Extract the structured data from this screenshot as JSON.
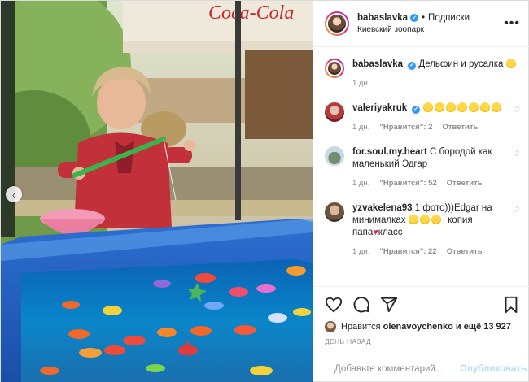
{
  "photo": {
    "background_sign": "Coca-Cola",
    "alt": "Девочка ловит игрушечную рыбку удочкой в надувном бассейне"
  },
  "header": {
    "username": "babaslavka",
    "separator": "•",
    "follow_state": "Подписки",
    "location": "Киевский зоопарк",
    "more": "•••"
  },
  "caption": {
    "username": "babaslavka",
    "text": "Дельфин и русалка",
    "time": "1 дн."
  },
  "comments": [
    {
      "username": "valeriyakruk",
      "verified": true,
      "time": "1 дн.",
      "likes": "\"Нравится\": 2",
      "reply": "Ответить"
    },
    {
      "username": "for.soul.my.heart",
      "text": "С бородой как маленький Эдгар",
      "time": "1 дн.",
      "likes": "\"Нравится\": 52",
      "reply": "Ответить"
    },
    {
      "username": "yzvakelena93",
      "text_parts": [
        "1 фото)))Edgar на минималках",
        ", копия папа",
        "класс"
      ],
      "time": "1 дн.",
      "likes": "\"Нравится\": 22",
      "reply": "Ответить"
    }
  ],
  "actions": {
    "likes_prefix": "Нравится",
    "liked_by": "olenavoychenko",
    "likes_suffix": "и ещё 13 927",
    "date": "ДЕНЬ НАЗАД"
  },
  "composer": {
    "placeholder": "Добавьте комментарий...",
    "publish": "Опубликовать"
  },
  "icons": [
    "chevron-left-icon",
    "verified-icon",
    "more-icon",
    "heart-icon",
    "comment-icon",
    "share-icon",
    "bookmark-icon",
    "smile-icon"
  ],
  "colors": {
    "accent": "#3897f0",
    "muted": "#8e8e8e",
    "publish_disabled": "#b2dffc",
    "text": "#262626"
  }
}
